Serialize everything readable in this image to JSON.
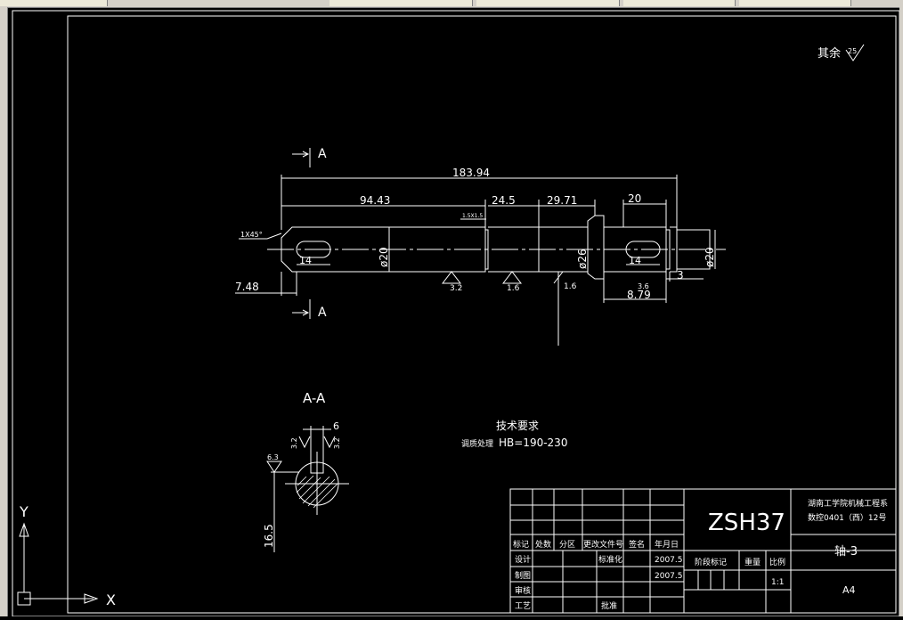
{
  "window": {
    "tabs": [
      "",
      "",
      "",
      "",
      ""
    ]
  },
  "drawing": {
    "roughness_note": "其余",
    "roughness_default": "25",
    "section_label_top": "A",
    "section_label_bottom": "A",
    "section_title": "A-A",
    "dims": {
      "overall": "183.94",
      "left_seg": "94.43",
      "mid_seg1": "24.5",
      "mid_seg2": "29.71",
      "right_seg": "20",
      "chamfer": "1X45°",
      "groove": "1.5X1.5",
      "dia_left": "ø20",
      "dia_mid": "ø26",
      "dia_right": "ø20",
      "key_left": "14",
      "key_right": "14",
      "left_offset": "7.48",
      "right_a": "3",
      "right_b": "8.79",
      "right_c": "3.6",
      "key_width": "6",
      "key_depth": "16.5"
    },
    "roughness_marks": [
      "3.2",
      "1.6",
      "1.6",
      "3.2",
      "3.2",
      "6.3"
    ],
    "requirements_title": "技术要求",
    "requirements_label": "调质处理",
    "requirements_value": "HB=190-230",
    "ucs_y": "Y",
    "ucs_x": "X"
  },
  "title_block": {
    "drawing_no": "ZSH37",
    "school_line1": "湖南工学院机械工程系",
    "school_line2": "数控0401（西）12号",
    "part_name": "轴-3",
    "paper_size": "A4",
    "headers": [
      "标记",
      "处数",
      "分区",
      "更改文件号",
      "签名",
      "年月日"
    ],
    "rows": [
      {
        "label": "设计",
        "mid": "标准化",
        "date": "2007.5"
      },
      {
        "label": "制图",
        "mid": "",
        "date": "2007.5"
      },
      {
        "label": "审核",
        "mid": "",
        "date": ""
      },
      {
        "label": "工艺",
        "mid": "批准",
        "date": ""
      }
    ],
    "stage_label": "阶段标记",
    "weight_label": "重量",
    "scale_label": "比例",
    "scale_value": "1:1"
  }
}
